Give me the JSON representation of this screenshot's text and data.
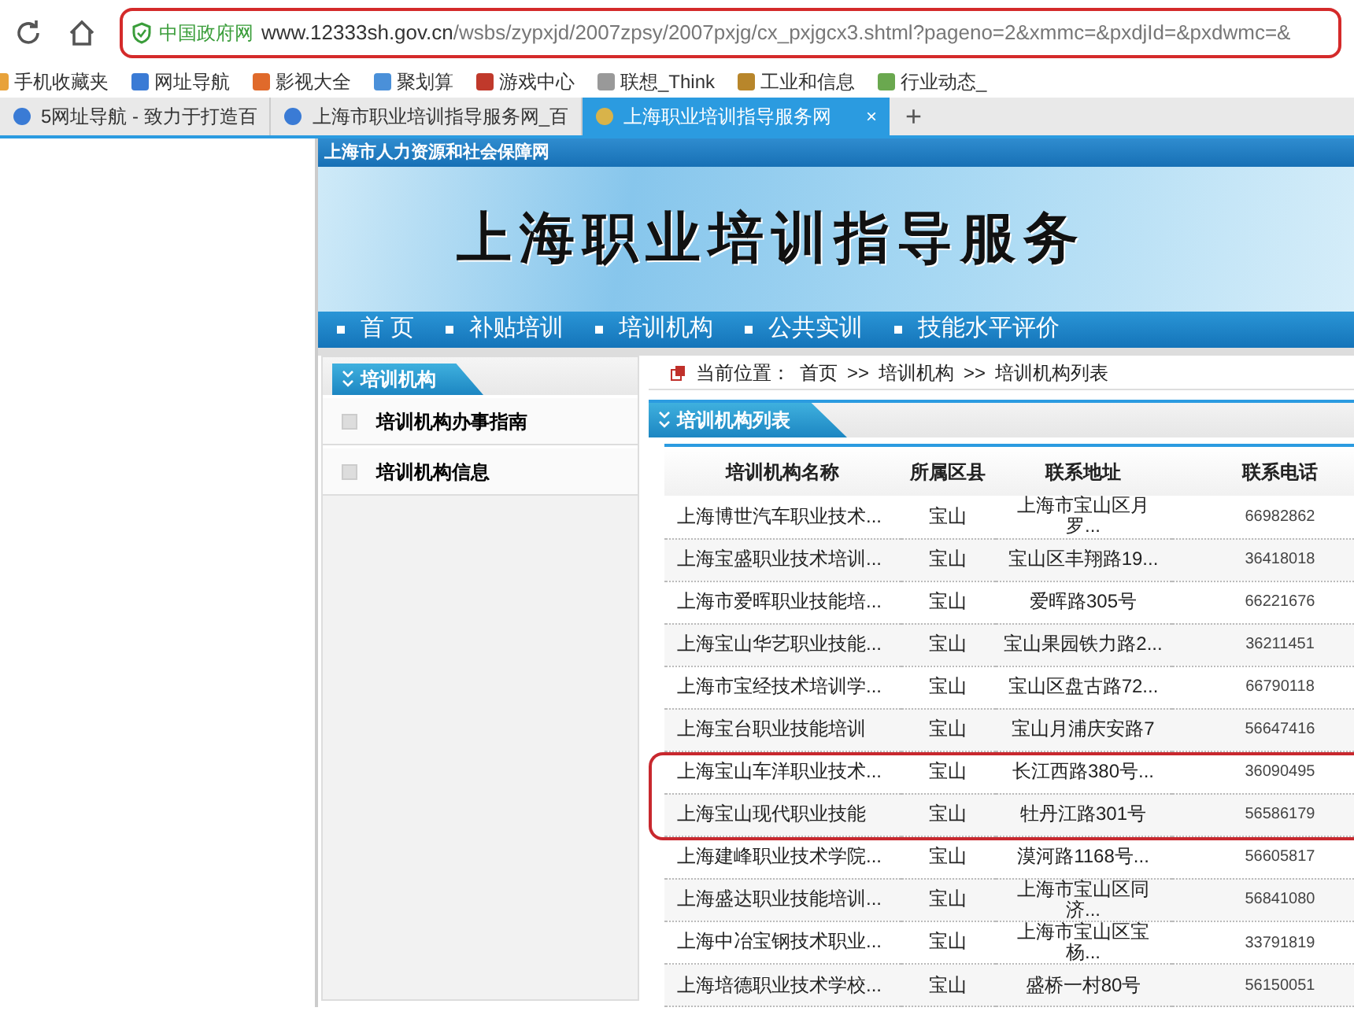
{
  "browser": {
    "security_label": "中国政府网",
    "url_host": "www.12333sh.gov.cn",
    "url_path": "/wsbs/zypxjd/2007zpsy/2007pxjg/cx_pxjgcx3.shtml?pageno=2&xmmc=&pxdjId=&pxdwmc=&",
    "bookmarks": [
      "手机收藏夹",
      "网址导航",
      "影视大全",
      "聚划算",
      "游戏中心",
      "联想_Think",
      "工业和信息",
      "行业动态_"
    ],
    "tabs": [
      {
        "title": "5网址导航 - 致力于打造百",
        "selected": false
      },
      {
        "title": "上海市职业培训指导服务网_百",
        "selected": false
      },
      {
        "title": "上海职业培训指导服务网",
        "selected": true,
        "close": "×"
      }
    ],
    "new_tab": "+"
  },
  "site": {
    "top_bar": "上海市人力资源和社会保障网",
    "banner_title": "上海职业培训指导服务",
    "nav": [
      "首 页",
      "补贴培训",
      "培训机构",
      "公共实训",
      "技能水平评价"
    ],
    "sidebar": {
      "title": "培训机构",
      "items": [
        "培训机构办事指南",
        "培训机构信息"
      ]
    },
    "breadcrumb": {
      "label": "当前位置：",
      "parts": [
        "首页",
        "培训机构",
        "培训机构列表"
      ],
      "separator": ">>"
    },
    "list_title": "培训机构列表",
    "table": {
      "columns": [
        "培训机构名称",
        "所属区县",
        "联系地址",
        "联系电话"
      ],
      "rows": [
        [
          "上海博世汽车职业技术...",
          "宝山",
          "上海市宝山区月罗...",
          "66982862"
        ],
        [
          "上海宝盛职业技术培训...",
          "宝山",
          "宝山区丰翔路19...",
          "36418018"
        ],
        [
          "上海市爱晖职业技能培...",
          "宝山",
          "爱晖路305号",
          "66221676"
        ],
        [
          "上海宝山华艺职业技能...",
          "宝山",
          "宝山果园铁力路2...",
          "36211451"
        ],
        [
          "上海市宝经技术培训学...",
          "宝山",
          "宝山区盘古路72...",
          "66790118"
        ],
        [
          "上海宝台职业技能培训",
          "宝山",
          "宝山月浦庆安路7",
          "56647416"
        ],
        [
          "上海宝山车洋职业技术...",
          "宝山",
          "长江西路380号...",
          "36090495"
        ],
        [
          "上海宝山现代职业技能",
          "宝山",
          "牡丹江路301号",
          "56586179"
        ],
        [
          "上海建峰职业技术学院...",
          "宝山",
          "漠河路1168号...",
          "56605817"
        ],
        [
          "上海盛达职业技能培训...",
          "宝山",
          "上海市宝山区同济...",
          "56841080"
        ],
        [
          "上海中冶宝钢技术职业...",
          "宝山",
          "上海市宝山区宝杨...",
          "33791819"
        ],
        [
          "上海培德职业技术学校...",
          "宝山",
          "盛桥一村80号",
          "56150051"
        ]
      ]
    }
  }
}
